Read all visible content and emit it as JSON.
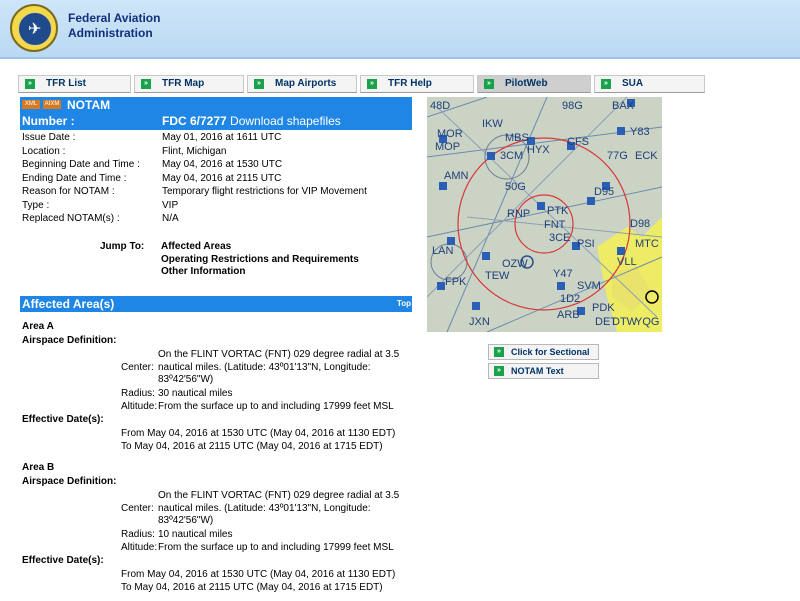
{
  "header": {
    "brand_line1": "Federal Aviation",
    "brand_line2": "Administration",
    "seal_text": "FEDERAL AVIATION ADMINISTRATION"
  },
  "nav": {
    "tabs": [
      {
        "label": "TFR List"
      },
      {
        "label": "TFR Map"
      },
      {
        "label": "Map Airports"
      },
      {
        "label": "TFR Help"
      },
      {
        "label": "PilotWeb",
        "active": true
      },
      {
        "label": "SUA"
      }
    ]
  },
  "notam": {
    "title": "NOTAM",
    "icon_xml": "XML",
    "icon_aixm": "AIXM",
    "number_label": "Number :",
    "number_value": "FDC 6/7277",
    "download_link": "Download shapefiles",
    "details": [
      {
        "key": "Issue Date :",
        "value": "May 01, 2016 at 1611 UTC"
      },
      {
        "key": "Location :",
        "value": "Flint, Michigan"
      },
      {
        "key": "Beginning Date and Time :",
        "value": "May 04, 2016 at 1530 UTC"
      },
      {
        "key": "Ending Date and Time :",
        "value": "May 04, 2016 at 2115 UTC"
      },
      {
        "key": "Reason for NOTAM :",
        "value": "Temporary flight restrictions for VIP Movement"
      },
      {
        "key": "Type :",
        "value": "VIP"
      },
      {
        "key": "Replaced NOTAM(s) :",
        "value": "N/A"
      }
    ],
    "jump_to_label": "Jump To:",
    "jump_links": [
      "Affected Areas",
      "Operating Restrictions and Requirements",
      "Other Information"
    ]
  },
  "affected": {
    "heading": "Affected Area(s)",
    "top_link": "Top",
    "areas": [
      {
        "title": "Area A",
        "airspace_label": "Airspace Definition:",
        "center_label": "Center:",
        "center_line1": "On the FLINT VORTAC (FNT) 029 degree radial at 3.5",
        "center_line2": "nautical miles. (Latitude: 43º01'13\"N, Longitude:",
        "center_line3": "83º42'56\"W)",
        "radius_label": "Radius:",
        "radius": "30 nautical miles",
        "altitude_label": "Altitude:",
        "altitude": "From the surface up to and including 17999 feet MSL",
        "effective_label": "Effective Date(s):",
        "from": "From May 04, 2016 at 1530 UTC (May 04, 2016 at 1130 EDT)",
        "to": "To May 04, 2016 at 2115 UTC (May 04, 2016 at 1715 EDT)"
      },
      {
        "title": "Area B",
        "airspace_label": "Airspace Definition:",
        "center_label": "Center:",
        "center_line1": "On the FLINT VORTAC (FNT) 029 degree radial at 3.5",
        "center_line2": "nautical miles. (Latitude: 43º01'13\"N, Longitude:",
        "center_line3": "83º42'56\"W)",
        "radius_label": "Radius:",
        "radius": "10 nautical miles",
        "altitude_label": "Altitude:",
        "altitude": "From the surface up to and including 17999 feet MSL",
        "effective_label": "Effective Date(s):",
        "from": "From May 04, 2016 at 1530 UTC (May 04, 2016 at 1130 EDT)",
        "to": "To May 04, 2016 at 2115 UTC (May 04, 2016 at 1715 EDT)"
      }
    ]
  },
  "map": {
    "labels": [
      "48D",
      "98G",
      "BAX",
      "MOR",
      "IKW",
      "MBS",
      "CFS",
      "Y83",
      "MOP",
      "3CM",
      "HYX",
      "77G",
      "ECK",
      "AMN",
      "50G",
      "D95",
      "RNP",
      "PTK",
      "FNT",
      "D98",
      "LAN",
      "3CE",
      "PSI",
      "MTC",
      "FPK",
      "TEW",
      "OZW",
      "Y47",
      "VLL",
      "SVM",
      "1D2",
      "ARB",
      "PDK",
      "DET",
      "YQG",
      "JXN",
      "DTW"
    ]
  },
  "side_buttons": {
    "sectional": "Click for Sectional",
    "notam_text": "NOTAM Text"
  },
  "colors": {
    "header_bg": "#c4dff6",
    "section_blue": "#1f86e6",
    "bullet_green": "#18a24a",
    "brand_navy": "#12307a"
  }
}
